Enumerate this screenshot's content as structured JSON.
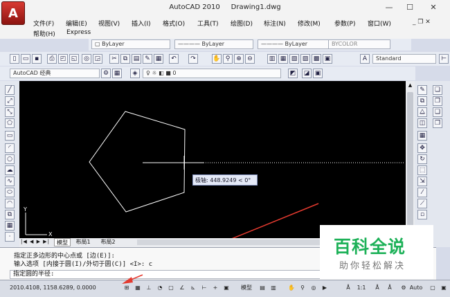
{
  "window": {
    "title": "AutoCAD 2010",
    "document": "Drawing1.dwg",
    "app_button": "A"
  },
  "menu": {
    "row1": [
      "文件(F)",
      "编辑(E)",
      "视图(V)",
      "插入(I)",
      "格式(O)",
      "工具(T)",
      "绘图(D)",
      "标注(N)",
      "修改(M)",
      "参数(P)",
      "窗口(W)"
    ],
    "row2": [
      "帮助(H)",
      "Express"
    ]
  },
  "properties_bar": {
    "color": "ByLayer",
    "linetype": "ByLayer",
    "lineweight": "ByLayer",
    "plotstyle": "BYCOLOR"
  },
  "style_bar": {
    "text_style": "Standard"
  },
  "workspace": {
    "name": "AutoCAD 经典"
  },
  "layer": {
    "current": "0"
  },
  "canvas": {
    "tooltip": "极轴: 448.9249 < 0°",
    "ucs_y": "Y",
    "ucs_x": "X",
    "background_color": "#000000",
    "line_color": "#ffffff",
    "annotation_color": "#e43a2f"
  },
  "tabs": {
    "model": "模型",
    "layout1": "布局1",
    "layout2": "布局2"
  },
  "command": {
    "history1": "指定正多边形的中心点或 [边(E)]:",
    "history2": "输入选项 [内接于圆(I)/外切于圆(C)] <I>: c",
    "prompt": "指定圆的半径:"
  },
  "status": {
    "coords": "2010.4108, 1158.6289, 0.0000",
    "model_label": "模型",
    "anno_scale": "1:1",
    "workspace_switch": "Auto"
  },
  "watermark": {
    "main": "百科全说",
    "sub": "助你轻松解决",
    "color": "#1db158"
  }
}
